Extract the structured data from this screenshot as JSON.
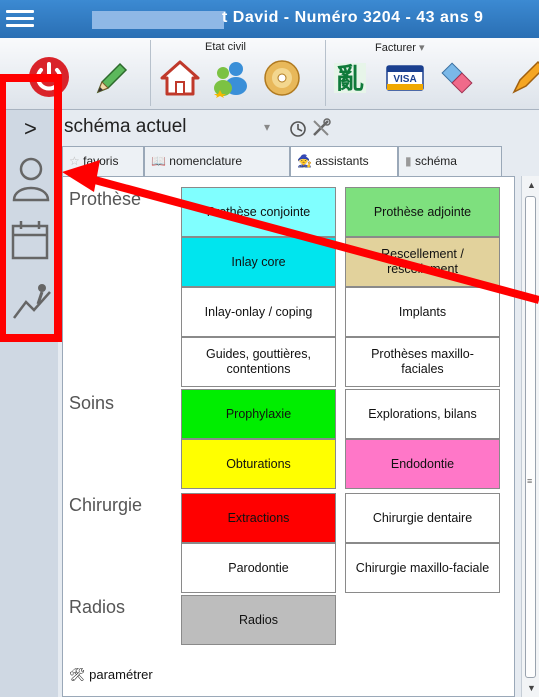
{
  "window": {
    "title": "t David  - Numéro 3204  -  43 ans 9"
  },
  "toolbar": {
    "etat_civil_label": "Etat civil",
    "facturer_label": "Facturer",
    "visa_text": "VISA",
    "icons": [
      "power-icon",
      "pencil-icon",
      "home-icon",
      "patients-icon",
      "disc-icon",
      "chinese-character-icon",
      "visa-card-icon",
      "eraser-icon",
      "pencil-orange-icon"
    ]
  },
  "leftbar": {
    "chevron": ">",
    "icons": [
      "user-icon",
      "calendar-icon",
      "climber-icon"
    ]
  },
  "panel": {
    "heading": "schéma actuel",
    "dropdown_arrow": "▾",
    "tabs": [
      "favoris",
      "nomenclature",
      "assistants",
      "schéma"
    ],
    "active_tab": "assistants"
  },
  "categories": [
    {
      "label": "Prothèse"
    },
    {
      "label": "Soins"
    },
    {
      "label": "Chirurgie"
    },
    {
      "label": "Radios"
    }
  ],
  "cells": [
    {
      "label": "Prothèse conjointe",
      "color": "#80ffff"
    },
    {
      "label": "Prothèse adjointe",
      "color": "#7ee07e"
    },
    {
      "label": "Inlay core",
      "color": "#00e5ee"
    },
    {
      "label": "Rescellement / rescellement",
      "color": "#e2d29c"
    },
    {
      "label": "Inlay-onlay / coping",
      "color": "#ffffff"
    },
    {
      "label": "Implants",
      "color": "#ffffff"
    },
    {
      "label": "Guides, gouttières, contentions",
      "color": "#ffffff"
    },
    {
      "label": "Prothèses maxillo-faciales",
      "color": "#ffffff"
    },
    {
      "label": "Prophylaxie",
      "color": "#00ee00"
    },
    {
      "label": "Explorations, bilans",
      "color": "#ffffff"
    },
    {
      "label": "Obturations",
      "color": "#ffff00"
    },
    {
      "label": "Endodontie",
      "color": "#ff77c8"
    },
    {
      "label": "Extractions",
      "color": "#ff0000"
    },
    {
      "label": "Chirurgie dentaire",
      "color": "#ffffff"
    },
    {
      "label": "Parodontie",
      "color": "#ffffff"
    },
    {
      "label": "Chirurgie maxillo-faciale",
      "color": "#ffffff"
    },
    {
      "label": "Radios",
      "color": "#bdbdbd"
    }
  ],
  "footer": {
    "parametrer": "paramétrer"
  },
  "annotation_colors": {
    "highlight": "#ff0000"
  }
}
